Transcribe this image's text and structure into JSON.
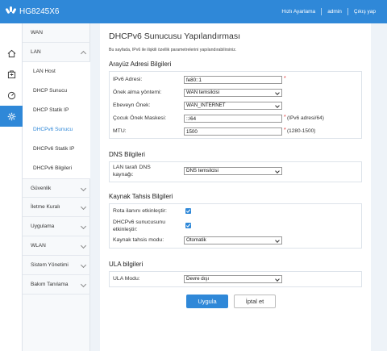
{
  "header": {
    "app_title": "HG8245X6",
    "links": [
      "Hızlı Ayarlama",
      "admin",
      "Çıkış yap"
    ]
  },
  "rail": {
    "items": [
      "home-icon",
      "device-icon",
      "speedometer-icon",
      "gear-icon"
    ],
    "active_index": 3
  },
  "menu": {
    "items": [
      {
        "label": "WAN"
      },
      {
        "label": "LAN"
      },
      {
        "label": "LAN Host"
      },
      {
        "label": "DHCP Sunucu"
      },
      {
        "label": "DHCP Statik IP"
      },
      {
        "label": "DHCPv6 Sunucu"
      },
      {
        "label": "DHCPv6 Statik IP"
      },
      {
        "label": "DHCPv6 Bilgileri"
      },
      {
        "label": "Güvenlik"
      },
      {
        "label": "İletme Kuralı"
      },
      {
        "label": "Uygulama"
      },
      {
        "label": "WLAN"
      },
      {
        "label": "Sistem Yönetimi"
      },
      {
        "label": "Bakım Tanılama"
      }
    ],
    "selected": "DHCPv6 Sunucu"
  },
  "page": {
    "title": "DHCPv6 Sunucusu Yapılandırması",
    "description": "Bu sayfada, IPv6 ile ilişkili özellik parametrelerini yapılandırabilirsiniz."
  },
  "section_interface": {
    "title": "Arayüz Adresi Bilgileri",
    "ipv6_label": "IPv6 Adresi:",
    "ipv6_value": "fe80::1",
    "prefix_method_label": "Önek alma yöntemi:",
    "prefix_method_value": "WAN temsilcisi",
    "parent_prefix_label": "Ebeveyn Önek:",
    "parent_prefix_value": "WAN_INTERNET",
    "child_mask_label": "Çocuk Önek Maskesi:",
    "child_mask_value": "::/64",
    "child_mask_hint": "(IPv6 adresi/64)",
    "mtu_label": "MTU:",
    "mtu_value": "1500",
    "mtu_hint": "(1280-1500)",
    "required_mark": "*"
  },
  "section_dns": {
    "title": "DNS Bilgileri",
    "lan_dns_label_line1": "LAN tarafı DNS",
    "lan_dns_label_line2": "kaynağı:",
    "lan_dns_value": "DNS temsilcisi"
  },
  "section_resource": {
    "title": "Kaynak Tahsis Bilgileri",
    "route_label": "Rota ilanını etkinleştir:",
    "route_checked": true,
    "dhcpv6_label_line1": "DHCPv6 sunucusunu",
    "dhcpv6_label_line2": "etkinleştir:",
    "dhcpv6_checked": true,
    "mode_label": "Kaynak tahsis modu:",
    "mode_value": "Otomatik"
  },
  "section_ula": {
    "title": "ULA bilgileri",
    "mode_label": "ULA Modu:",
    "mode_value": "Devre dışı"
  },
  "actions": {
    "apply_label": "Uygula",
    "cancel_label": "İptal et"
  },
  "colors": {
    "brand": "#2f88d8",
    "required": "#e0302f"
  }
}
